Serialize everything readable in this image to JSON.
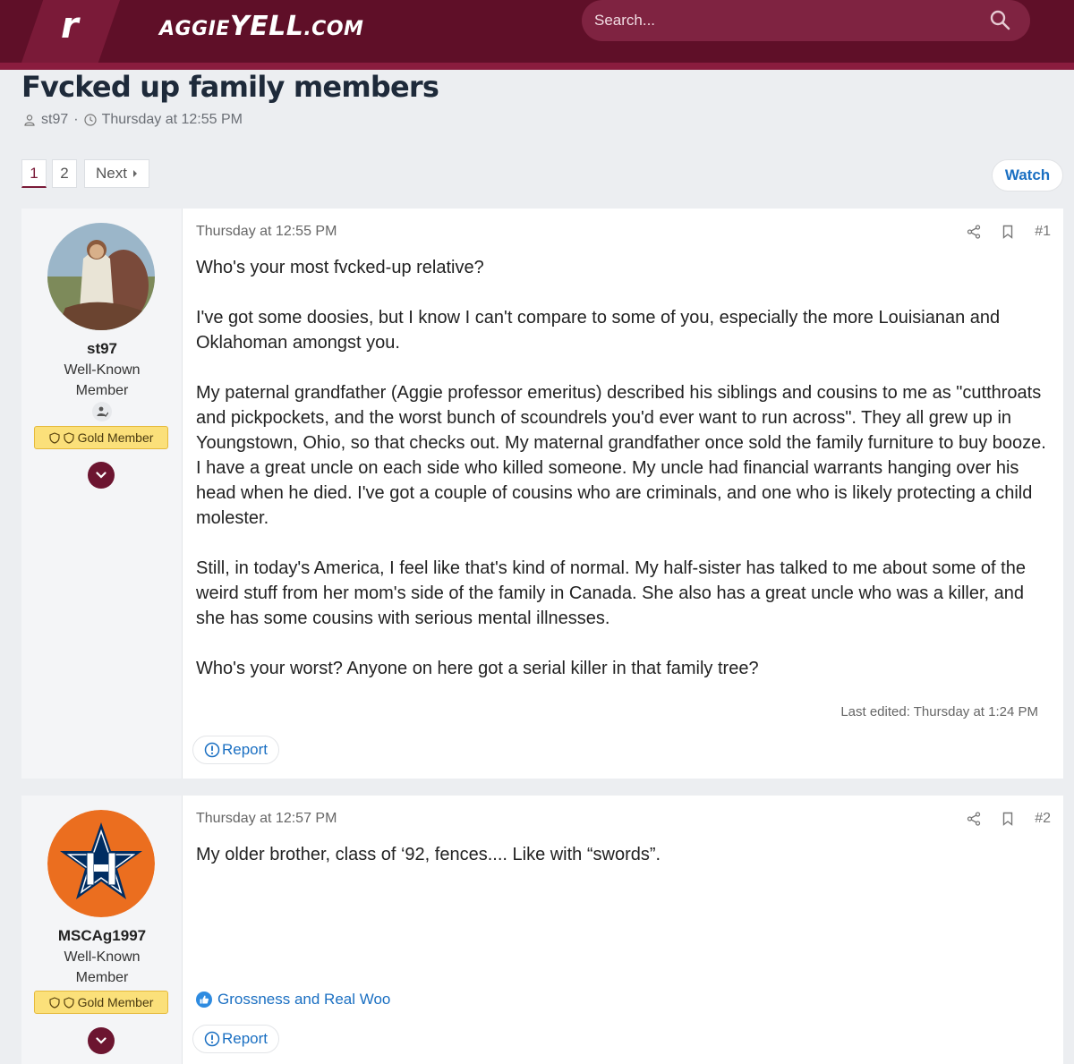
{
  "header": {
    "logo_letter": "r",
    "brand_prefix": "AGGIE",
    "brand_middle": "YELL",
    "brand_suffix": ".COM",
    "search_placeholder": "Search..."
  },
  "thread": {
    "title": "Fvcked up family members",
    "author": "st97",
    "separator": "·",
    "date": "Thursday at 12:55 PM"
  },
  "pagination": {
    "pages": [
      "1",
      "2"
    ],
    "next_label": "Next",
    "watch_label": "Watch"
  },
  "posts": [
    {
      "username": "st97",
      "title_line1": "Well-Known",
      "title_line2": "Member",
      "badge": "Gold Member",
      "date": "Thursday at 12:55 PM",
      "number": "#1",
      "paragraphs": [
        "Who's your most fvcked-up relative?",
        "I've got some doosies, but I know I can't compare to some of you, especially the more Louisianan and Oklahoman amongst you.",
        "My paternal grandfather (Aggie professor emeritus) described his siblings and cousins to me as \"cutthroats and pickpockets, and the worst bunch of scoundrels you'd ever want to run across\". They all grew up in Youngstown, Ohio, so that checks out. My maternal grandfather once sold the family furniture to buy booze. I have a great uncle on each side who killed someone. My uncle had financial warrants hanging over his head when he died. I've got a couple of cousins who are criminals, and one who is likely protecting a child molester.",
        "Still, in today's America, I feel like that's kind of normal. My half-sister has talked to me about some of the weird stuff from her mom's side of the family in Canada. She also has a great uncle who was a killer, and she has some cousins with serious mental illnesses.",
        "Who's your worst? Anyone on here got a serial killer in that family tree?"
      ],
      "edited": "Last edited: Thursday at 1:24 PM",
      "report_label": "Report"
    },
    {
      "username": "MSCAg1997",
      "title_line1": "Well-Known",
      "title_line2": "Member",
      "badge": "Gold Member",
      "date": "Thursday at 12:57 PM",
      "number": "#2",
      "paragraphs": [
        "My older brother, class of ‘92, fences.... Like with “swords”."
      ],
      "reaction": "Grossness and Real Woo",
      "report_label": "Report"
    }
  ],
  "colors": {
    "header_bg": "#5f0f28",
    "accent": "#7a1a38",
    "link": "#1a6fc2",
    "gold_badge": "#fbe07a",
    "astros_orange": "#eb6e1f",
    "astros_navy": "#002d62"
  },
  "icons": [
    "search-icon",
    "user-icon",
    "clock-icon",
    "share-icon",
    "bookmark-icon",
    "report-icon",
    "shield-icon",
    "chevron-down-icon",
    "like-icon",
    "member-badge-icon"
  ]
}
